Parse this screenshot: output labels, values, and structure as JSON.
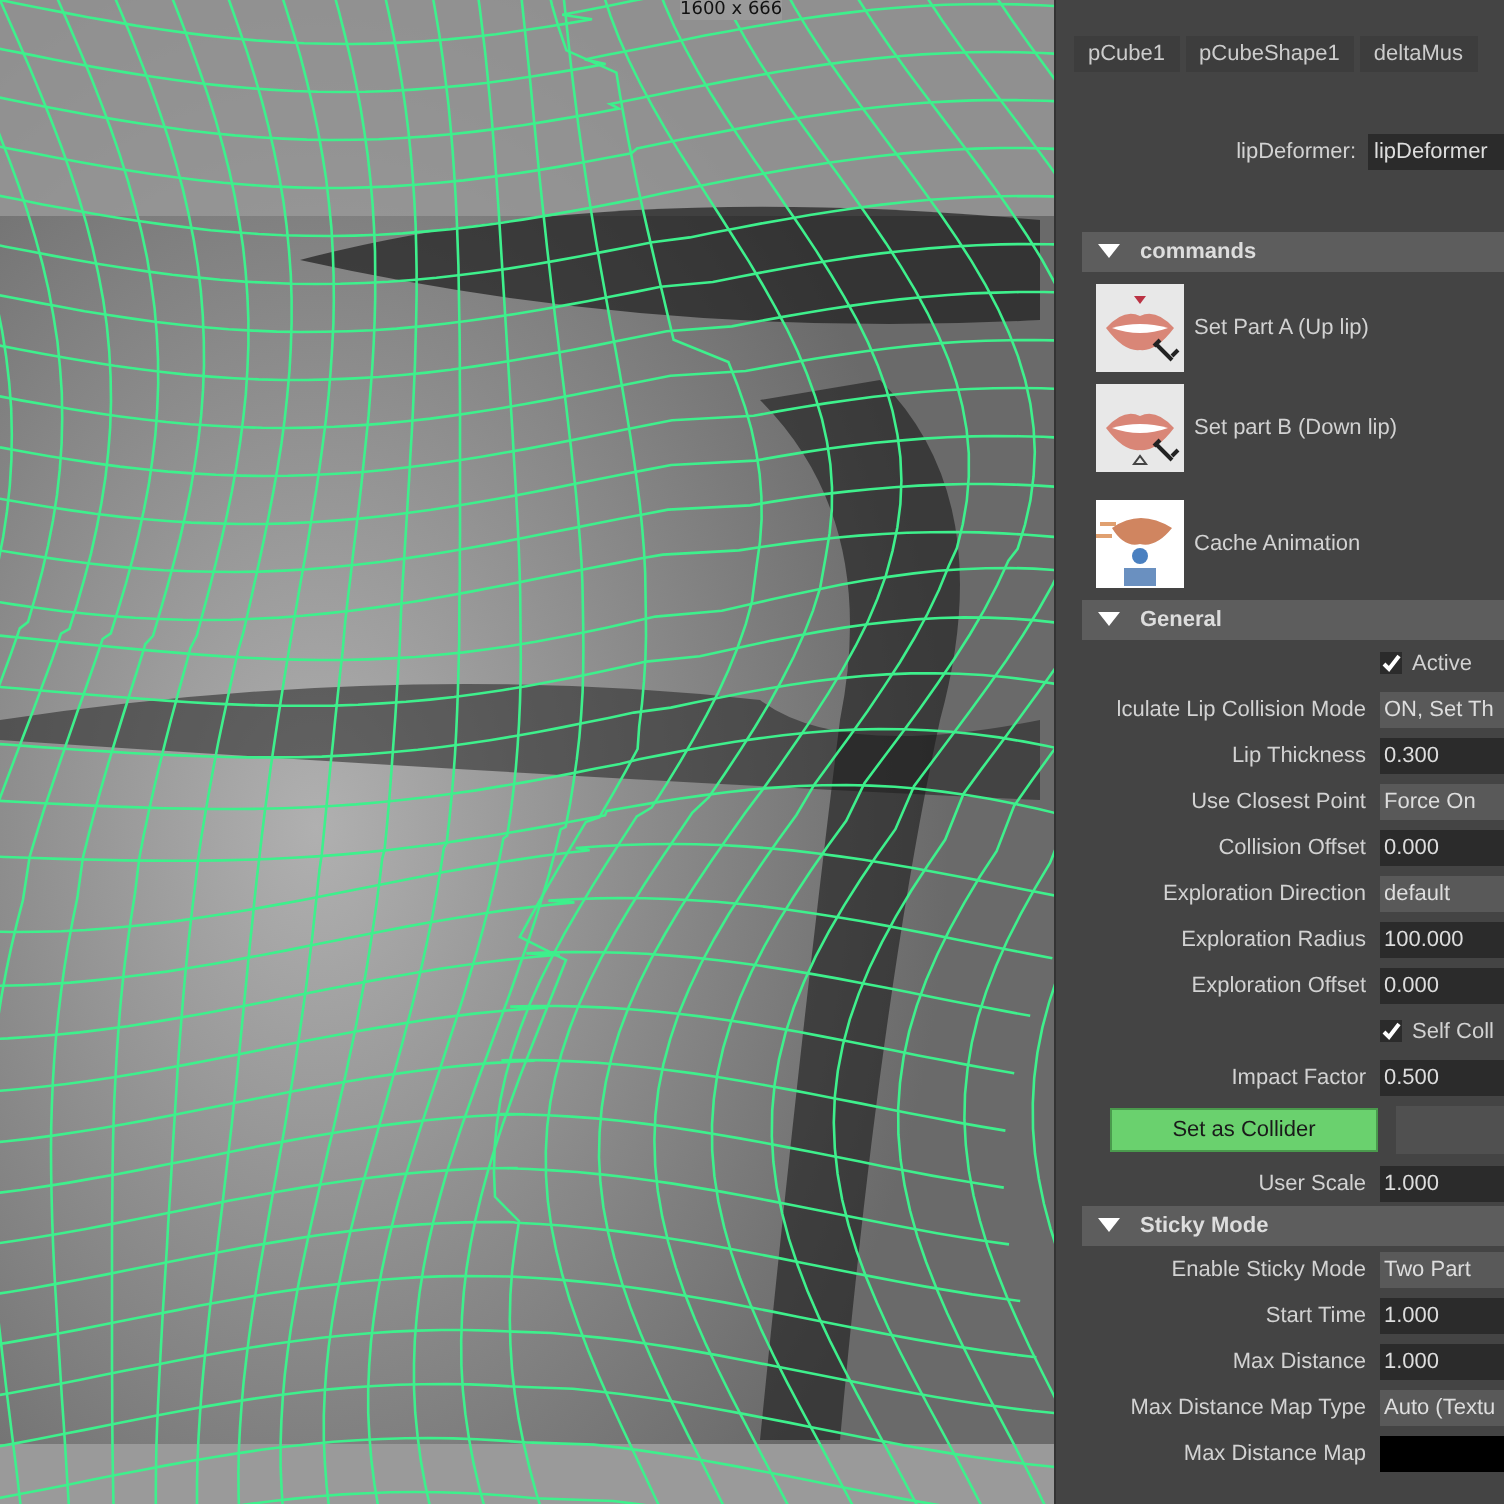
{
  "viewport": {
    "resolution_label": "1600 x 666"
  },
  "attribute_editor": {
    "tabs": [
      {
        "label": "pCube1",
        "selected": false
      },
      {
        "label": "pCubeShape1",
        "selected": false
      },
      {
        "label": "deltaMus",
        "selected": false
      }
    ],
    "node_field": {
      "label": "lipDeformer:",
      "value": "lipDeformer"
    },
    "sections": [
      {
        "title": "commands",
        "expanded": true,
        "commands": [
          {
            "label": "Set Part A (Up lip)"
          },
          {
            "label": "Set part B (Down lip)"
          },
          {
            "label": "Cache Animation"
          }
        ]
      },
      {
        "title": "General",
        "expanded": true,
        "rows": [
          {
            "kind": "checkbox",
            "label": "Active",
            "checked": true
          },
          {
            "kind": "enum",
            "label": "lculate Lip Collision Mode",
            "value": "ON, Set Th"
          },
          {
            "kind": "float",
            "label": "Lip Thickness",
            "value": "0.300"
          },
          {
            "kind": "enum",
            "label": "Use Closest Point",
            "value": "Force On"
          },
          {
            "kind": "float",
            "label": "Collision Offset",
            "value": "0.000"
          },
          {
            "kind": "enum",
            "label": "Exploration Direction",
            "value": "default"
          },
          {
            "kind": "float",
            "label": "Exploration Radius",
            "value": "100.000"
          },
          {
            "kind": "float",
            "label": "Exploration Offset",
            "value": "0.000"
          },
          {
            "kind": "checkbox",
            "label": "Self Coll",
            "checked": true
          },
          {
            "kind": "float",
            "label": "Impact Factor",
            "value": "0.500"
          },
          {
            "kind": "button",
            "label": "Set as Collider"
          },
          {
            "kind": "float",
            "label": "User Scale",
            "value": "1.000"
          }
        ]
      },
      {
        "title": "Sticky Mode",
        "expanded": true,
        "rows": [
          {
            "kind": "enum",
            "label": "Enable Sticky Mode",
            "value": "Two Part"
          },
          {
            "kind": "float",
            "label": "Start Time",
            "value": "1.000"
          },
          {
            "kind": "float",
            "label": "Max Distance",
            "value": "1.000"
          },
          {
            "kind": "enum",
            "label": "Max Distance Map Type",
            "value": "Auto (Textu"
          },
          {
            "kind": "map",
            "label": "Max Distance Map"
          }
        ]
      }
    ]
  }
}
